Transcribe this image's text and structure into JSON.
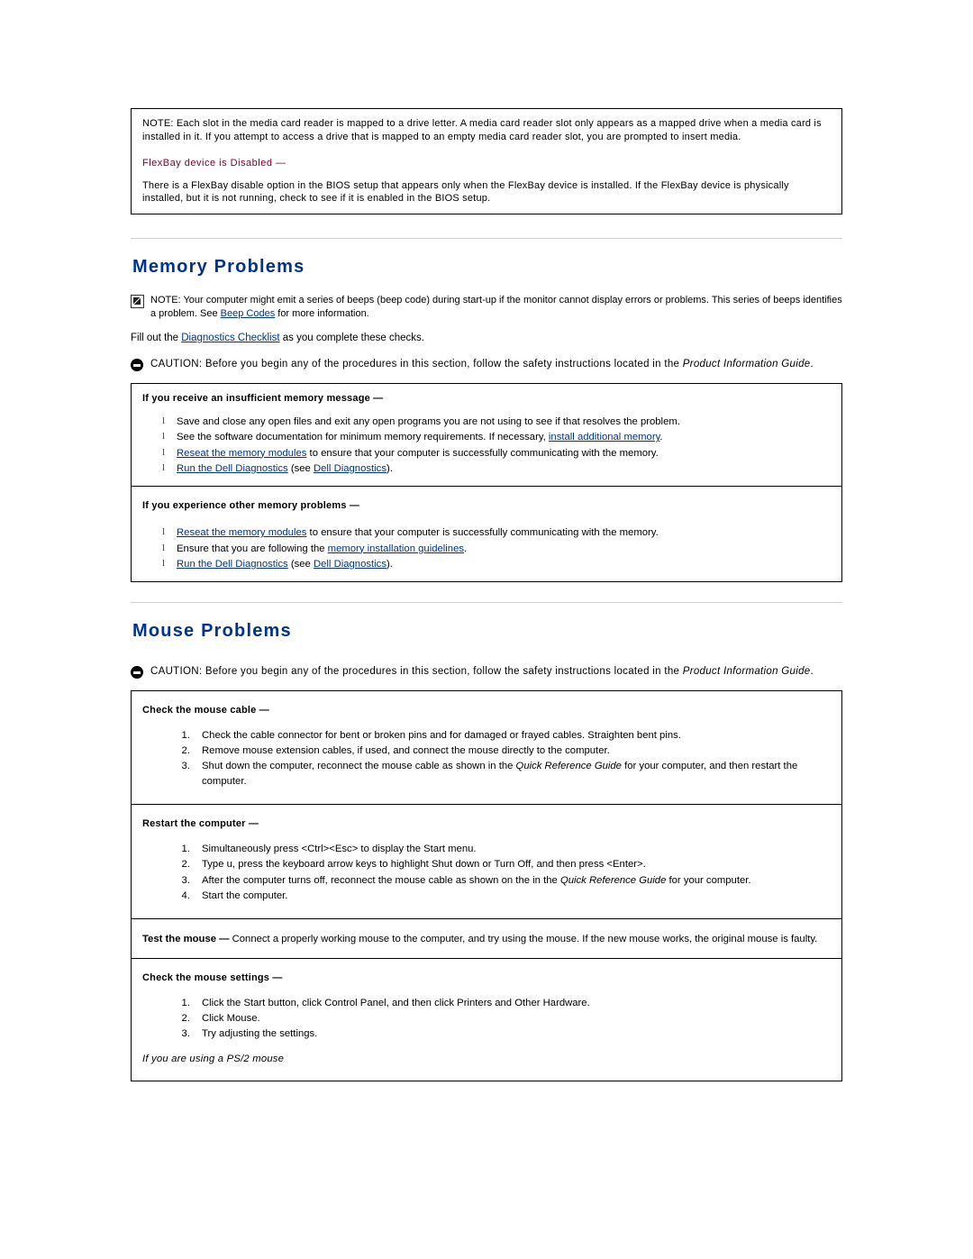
{
  "top_note": {
    "label": "NOTE:",
    "body": "Each slot in the media card reader is mapped to a drive letter. A media card reader slot only appears as a mapped drive when a media card is installed in it. If you attempt to access a drive that is mapped to an empty media card reader slot, you are prompted to insert media.",
    "sub_head": "FlexBay device is Disabled —",
    "sub_body": "There is a FlexBay disable option in the BIOS setup that appears only when the FlexBay device is installed. If the FlexBay device is physically installed, but it is not running, check to see if it is enabled in the BIOS setup."
  },
  "memory": {
    "title": "Memory Problems",
    "note_label": "NOTE:",
    "note_part1": "Your computer might emit a series of beeps (beep code) during start-up if the monitor cannot display errors or problems. This series of beeps identifies a problem. See ",
    "note_link": "Beep Codes",
    "note_part2": " for more information.",
    "fill_out_part1": "Fill out the ",
    "fill_out_link": "Diagnostics Checklist",
    "fill_out_part2": " as you complete these checks.",
    "caution_label": "CAUTION:",
    "caution_part1": " Before you begin any of the procedures in this section, follow the safety instructions located in the ",
    "caution_italic": "Product Information Guide",
    "caution_part2": ".",
    "blocks": [
      {
        "heading": "If you receive an insufficient memory message —",
        "items": [
          {
            "segments": [
              {
                "text": "Save and close any open files and exit any open programs you are not using to see if that resolves the problem.",
                "link": false
              }
            ]
          },
          {
            "segments": [
              {
                "text": "See the software documentation for minimum memory requirements. If necessary, ",
                "link": false
              },
              {
                "text": "install additional memory",
                "link": true
              },
              {
                "text": ".",
                "link": false
              }
            ]
          },
          {
            "segments": [
              {
                "text": "Reseat the memory modules",
                "link": true
              },
              {
                "text": " to ensure that your computer is successfully communicating with the memory.",
                "link": false
              }
            ]
          },
          {
            "segments": [
              {
                "text": "Run the Dell Diagnostics",
                "link": true
              },
              {
                "text": " (see ",
                "link": false
              },
              {
                "text": "Dell Diagnostics",
                "link": true
              },
              {
                "text": ").",
                "link": false
              }
            ]
          }
        ]
      },
      {
        "heading": "If you experience other memory problems —",
        "items": [
          {
            "segments": [
              {
                "text": "Reseat the memory modules",
                "link": true
              },
              {
                "text": " to ensure that your computer is successfully communicating with the memory.",
                "link": false
              }
            ]
          },
          {
            "segments": [
              {
                "text": "Ensure that you are following the ",
                "link": false
              },
              {
                "text": "memory installation guidelines",
                "link": true
              },
              {
                "text": ".",
                "link": false
              }
            ]
          },
          {
            "segments": [
              {
                "text": "Run the Dell Diagnostics",
                "link": true
              },
              {
                "text": " (see ",
                "link": false
              },
              {
                "text": "Dell Diagnostics",
                "link": true
              },
              {
                "text": ").",
                "link": false
              }
            ]
          }
        ]
      }
    ]
  },
  "mouse": {
    "title": "Mouse Problems",
    "caution_label": "CAUTION:",
    "caution_part1": " Before you begin any of the procedures in this section, follow the safety instructions located in the ",
    "caution_italic": "Product Information Guide",
    "caution_part2": ".",
    "block1": {
      "heading": "Check the mouse cable —",
      "steps": [
        [
          {
            "text": "Check the cable connector for bent or broken pins and for damaged or frayed cables. Straighten bent pins.",
            "style": "normal"
          }
        ],
        [
          {
            "text": "Remove mouse extension cables, if used, and connect the mouse directly to the computer.",
            "style": "normal"
          }
        ],
        [
          {
            "text": "Shut down the computer, reconnect the mouse cable as shown in the ",
            "style": "normal"
          },
          {
            "text": "Quick Reference Guide",
            "style": "italic"
          },
          {
            "text": " for your computer, and then restart the computer.",
            "style": "normal"
          }
        ]
      ]
    },
    "block2": {
      "heading": "Restart the computer —",
      "steps": [
        [
          {
            "text": "Simultaneously press <Ctrl><Esc> to display the Start menu.",
            "style": "normal"
          }
        ],
        [
          {
            "text": "Type u, press the keyboard arrow keys to highlight Shut down or Turn Off, and then press <Enter>.",
            "style": "normal"
          }
        ],
        [
          {
            "text": "After the computer turns off, reconnect the mouse cable as shown on the in the ",
            "style": "normal"
          },
          {
            "text": "Quick Reference Guide",
            "style": "italic"
          },
          {
            "text": " for your computer.",
            "style": "normal"
          }
        ],
        [
          {
            "text": "Start the computer.",
            "style": "normal"
          }
        ]
      ]
    },
    "block3": {
      "heading": "Test the mouse —",
      "body": " Connect a properly working mouse to the computer, and try using the mouse. If the new mouse works, the original mouse is faulty."
    },
    "block4": {
      "heading": "Check the mouse settings —",
      "steps": [
        [
          {
            "text": "Click the Start button, click Control Panel, and then click Printers and Other Hardware.",
            "style": "normal"
          }
        ],
        [
          {
            "text": "Click Mouse.",
            "style": "normal"
          }
        ],
        [
          {
            "text": "Try adjusting the settings.",
            "style": "normal"
          }
        ]
      ],
      "trailer": "If you are using a PS/2 mouse"
    }
  }
}
